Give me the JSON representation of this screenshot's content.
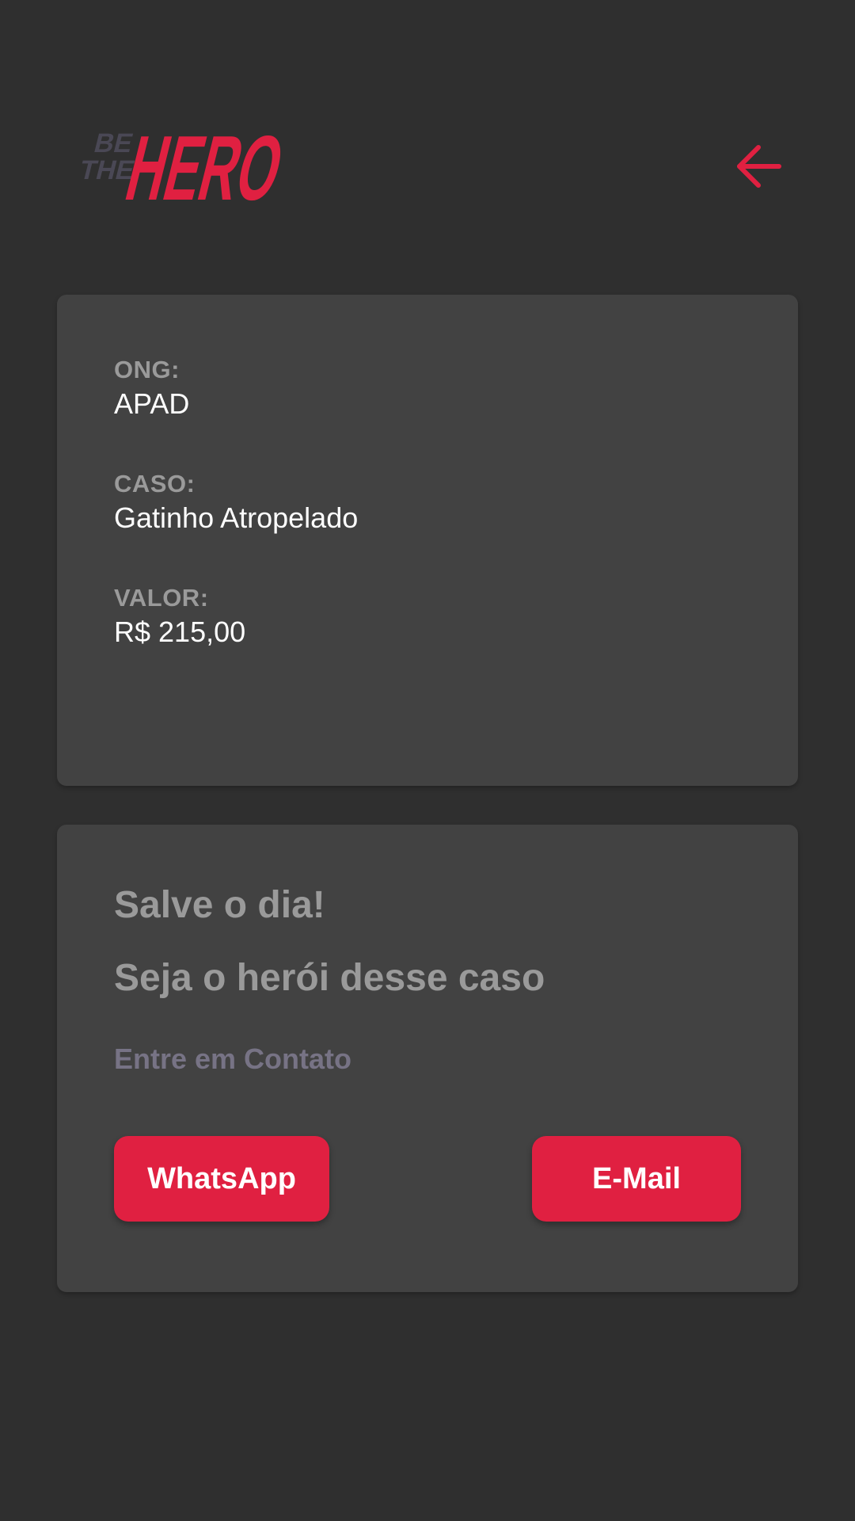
{
  "app": {
    "logo_text_small_line1": "BE",
    "logo_text_small_line2": "THE",
    "logo_text_big": "HERO",
    "back_icon": "arrow-left-icon"
  },
  "colors": {
    "background": "#2f2f2f",
    "card": "#424242",
    "accent": "#e02041",
    "label": "#9a9a9a",
    "value": "#ffffff",
    "muted": "#777385"
  },
  "incident": {
    "ong_label": "ONG:",
    "ong_value": "APAD",
    "caso_label": "CASO:",
    "caso_value": "Gatinho Atropelado",
    "valor_label": "VALOR:",
    "valor_value": "R$ 215,00"
  },
  "contact": {
    "title_line1": "Salve o dia!",
    "title_line2": "Seja o herói desse caso",
    "subtitle": "Entre em Contato",
    "whatsapp_label": "WhatsApp",
    "email_label": "E-Mail"
  }
}
